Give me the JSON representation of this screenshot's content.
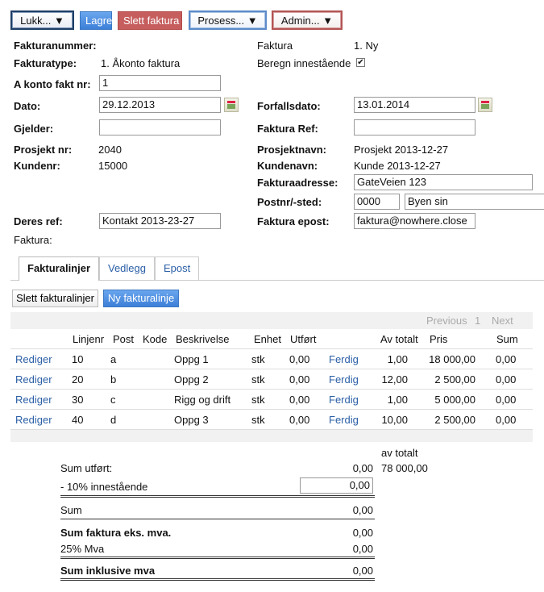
{
  "toolbar": {
    "close_label": "Lukk... ▼",
    "save_label": "Lagre",
    "delete_label": "Slett faktura",
    "process_label": "Prosess... ▼",
    "admin_label": "Admin... ▼"
  },
  "form": {
    "invoice_number_label": "Fakturanummer:",
    "invoice_label": "Faktura",
    "invoice_value": "1. Ny",
    "invoice_type_label": "Fakturatype:",
    "invoice_type_value": "1. Åkonto faktura",
    "calc_outstanding_label": "Beregn innestående",
    "account_invoice_label": "A konto fakt nr:",
    "account_invoice_value": "1",
    "date_label": "Dato:",
    "date_value": "29.12.2013",
    "due_date_label": "Forfallsdato:",
    "due_date_value": "13.01.2014",
    "applies_label": "Gjelder:",
    "applies_value": "",
    "invoice_ref_label": "Faktura Ref:",
    "invoice_ref_value": "",
    "project_nr_label": "Prosjekt nr:",
    "project_nr_value": "2040",
    "project_name_label": "Prosjektnavn:",
    "project_name_value": "Prosjekt 2013-12-27",
    "customer_nr_label": "Kundenr:",
    "customer_nr_value": "15000",
    "customer_name_label": "Kundenavn:",
    "customer_name_value": "Kunde 2013-12-27",
    "invoice_address_label": "Fakturaadresse:",
    "invoice_address_value": "GateVeien 123",
    "postal_label": "Postnr/-sted:",
    "postal_code_value": "0000",
    "postal_place_value": "Byen sin",
    "your_ref_label": "Deres ref:",
    "your_ref_value": "Kontakt 2013-23-27",
    "invoice_email_label": "Faktura epost:",
    "invoice_email_value": "faktura@nowhere.close",
    "invoice_footer_label": "Faktura:"
  },
  "tabs": [
    {
      "label": "Fakturalinjer"
    },
    {
      "label": "Vedlegg"
    },
    {
      "label": "Epost"
    }
  ],
  "lines": {
    "delete_label": "Slett fakturalinjer",
    "new_label": "Ny fakturalinje",
    "pager_prev": "Previous",
    "pager_page": "1",
    "pager_next": "Next",
    "headers": {
      "line_no": "Linjenr",
      "post": "Post",
      "code": "Kode",
      "description": "Beskrivelse",
      "unit": "Enhet",
      "done": "Utført",
      "of_total": "Av totalt",
      "price": "Pris",
      "sum": "Sum"
    },
    "rows": [
      {
        "edit": "Rediger",
        "line_no": "10",
        "post": "a",
        "code": "",
        "description": "Oppg 1",
        "unit": "stk",
        "done": "0,00",
        "status": "Ferdig",
        "of_total": "1,00",
        "price": "18 000,00",
        "sum": "0,00"
      },
      {
        "edit": "Rediger",
        "line_no": "20",
        "post": "b",
        "code": "",
        "description": "Oppg 2",
        "unit": "stk",
        "done": "0,00",
        "status": "Ferdig",
        "of_total": "12,00",
        "price": "2 500,00",
        "sum": "0,00"
      },
      {
        "edit": "Rediger",
        "line_no": "30",
        "post": "c",
        "code": "",
        "description": "Rigg og drift",
        "unit": "stk",
        "done": "0,00",
        "status": "Ferdig",
        "of_total": "1,00",
        "price": "5 000,00",
        "sum": "0,00"
      },
      {
        "edit": "Rediger",
        "line_no": "40",
        "post": "d",
        "code": "",
        "description": "Oppg 3",
        "unit": "stk",
        "done": "0,00",
        "status": "Ferdig",
        "of_total": "10,00",
        "price": "2 500,00",
        "sum": "0,00"
      }
    ]
  },
  "summary": {
    "of_total_header": "av totalt",
    "sum_done_label": "Sum utført:",
    "sum_done_value": "0,00",
    "sum_done_total": "78 000,00",
    "retention_label": "- 10% innestående",
    "retention_value": "0,00",
    "sum_label": "Sum",
    "sum_value": "0,00",
    "sum_ex_vat_label": "Sum faktura eks. mva.",
    "sum_ex_vat_value": "0,00",
    "vat_label": "25% Mva",
    "vat_value": "0,00",
    "sum_inc_vat_label": "Sum inklusive mva",
    "sum_inc_vat_value": "0,00"
  }
}
